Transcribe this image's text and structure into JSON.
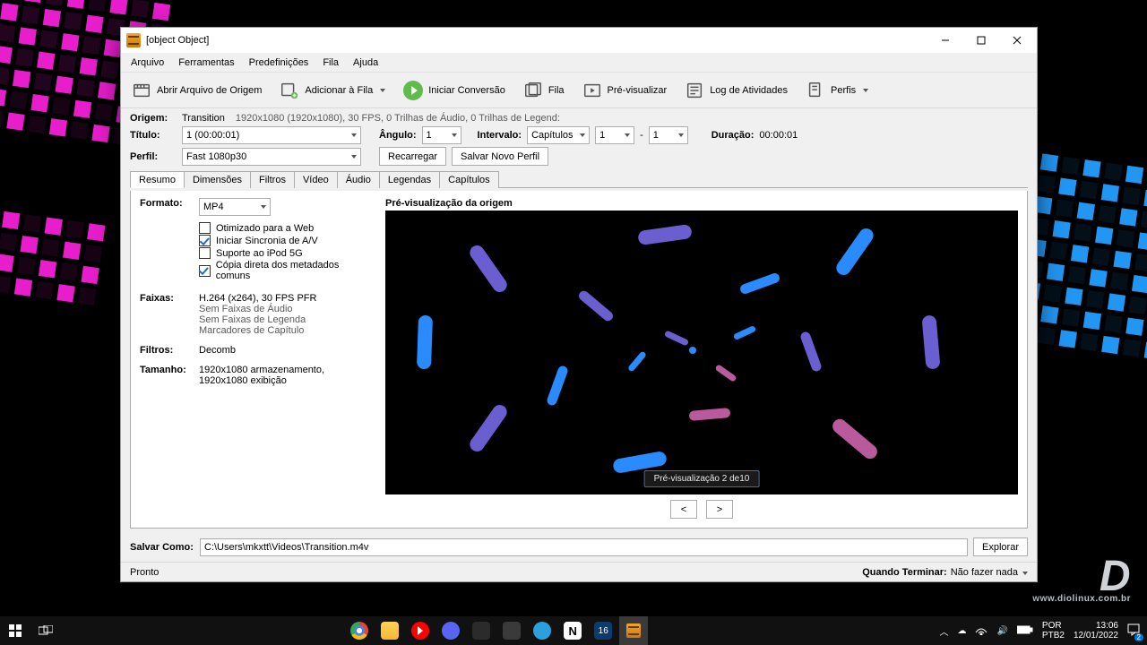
{
  "window": {
    "title": {
      "label": "Título:",
      "value": "1  (00:00:01)"
    },
    "menu": [
      "Arquivo",
      "Ferramentas",
      "Predefinições",
      "Fila",
      "Ajuda"
    ],
    "toolbar": {
      "open": "Abrir Arquivo de Origem",
      "addqueue": "Adicionar à Fila",
      "start": "Iniciar Conversão",
      "queue": "Fila",
      "preview": "Pré-visualizar",
      "log": "Log de Atividades",
      "profiles": "Perfis"
    },
    "source": {
      "label": "Origem:",
      "name": "Transition",
      "info": "1920x1080 (1920x1080), 30 FPS, 0 Trilhas de Áudio, 0 Trilhas de Legend:"
    },
    "angle": {
      "label": "Ângulo:",
      "value": "1"
    },
    "range": {
      "label": "Intervalo:",
      "mode": "Capítulos",
      "from": "1",
      "dash": "-",
      "to": "1"
    },
    "duration": {
      "label": "Duração:",
      "value": "00:00:01"
    },
    "profile": {
      "label": "Perfil:",
      "value": "Fast 1080p30",
      "reload": "Recarregar",
      "savenew": "Salvar Novo Perfil"
    },
    "tabs": [
      "Resumo",
      "Dimensões",
      "Filtros",
      "Vídeo",
      "Áudio",
      "Legendas",
      "Capítulos"
    ],
    "summary": {
      "format_label": "Formato:",
      "format": "MP4",
      "opts": {
        "web": "Otimizado para a Web",
        "av": "Iniciar Sincronia de A/V",
        "ipod": "Suporte ao iPod 5G",
        "meta": "Cópia direta dos metadados comuns"
      },
      "checked": {
        "web": false,
        "av": true,
        "ipod": false,
        "meta": true
      },
      "tracks_label": "Faixas:",
      "tracks": [
        "H.264 (x264), 30 FPS PFR",
        "Sem Faixas de Áudio",
        "Sem Faixas de Legenda",
        "Marcadores de Capítulo"
      ],
      "filters_label": "Filtros:",
      "filters": "Decomb",
      "size_label": "Tamanho:",
      "size": "1920x1080 armazenamento, 1920x1080 exibição"
    },
    "preview": {
      "title": "Pré-visualização da origem",
      "badge": "Pré-visualização 2 de10",
      "prev": "<",
      "next": ">"
    },
    "save": {
      "label": "Salvar Como:",
      "path": "C:\\Users\\mkxtt\\Videos\\Transition.m4v",
      "browse": "Explorar"
    },
    "status": {
      "ready": "Pronto",
      "whendone_label": "Quando Terminar:",
      "whendone": "Não fazer nada"
    }
  },
  "taskbar": {
    "lang1": "POR",
    "lang2": "PTB2",
    "time": "13:06",
    "date": "12/01/2022",
    "notif": "2"
  }
}
